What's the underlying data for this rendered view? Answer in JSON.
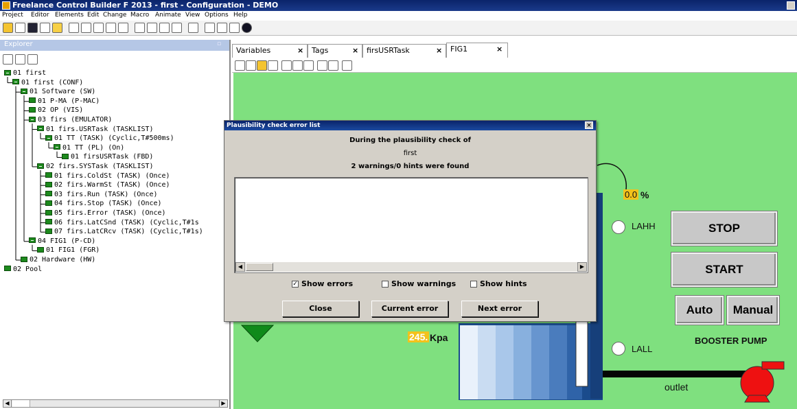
{
  "window": {
    "title": "Freelance Control Builder F 2013 - first - Configuration - DEMO"
  },
  "menu": [
    "Project",
    "Editor",
    "Elements",
    "Edit",
    "Change",
    "Macro",
    "Animate",
    "View",
    "Options",
    "Help"
  ],
  "explorer": {
    "title": "Explorer",
    "tree": [
      {
        "label": "01 first",
        "level": 0
      },
      {
        "label": "01 first  (CONF)",
        "level": 1
      },
      {
        "label": "01 Software  (SW)",
        "level": 2
      },
      {
        "label": "01 P-MA  (P-MAC)",
        "level": 3
      },
      {
        "label": "02 OP  (VIS)",
        "level": 3
      },
      {
        "label": "03 firs  (EMULATOR)",
        "level": 3
      },
      {
        "label": "01 firs.USRTask  (TASKLIST)",
        "level": 4
      },
      {
        "label": "01 TT  (TASK) (Cyclic,T#500ms)",
        "level": 5
      },
      {
        "label": "01 TT  (PL) (On)",
        "level": 6
      },
      {
        "label": "01 firsUSRTask  (FBD)",
        "level": 7
      },
      {
        "label": "02 firs.SYSTask  (TASKLIST)",
        "level": 4
      },
      {
        "label": "01 firs.ColdSt  (TASK) (Once)",
        "level": 5
      },
      {
        "label": "02 firs.WarmSt  (TASK) (Once)",
        "level": 5
      },
      {
        "label": "03 firs.Run  (TASK) (Once)",
        "level": 5
      },
      {
        "label": "04 firs.Stop  (TASK) (Once)",
        "level": 5
      },
      {
        "label": "05 firs.Error  (TASK) (Once)",
        "level": 5
      },
      {
        "label": "06 firs.LatCSnd  (TASK) (Cyclic,T#1s",
        "level": 5
      },
      {
        "label": "07 firs.LatCRcv  (TASK) (Cyclic,T#1s)",
        "level": 5
      },
      {
        "label": "04 FIG1  (P-CD)",
        "level": 3
      },
      {
        "label": "01 FIG1  (FGR)",
        "level": 4
      },
      {
        "label": "02 Hardware  (HW)",
        "level": 2
      },
      {
        "label": "02 Pool",
        "level": 0
      }
    ]
  },
  "tabs": [
    {
      "label": "Variables"
    },
    {
      "label": "Tags"
    },
    {
      "label": "firsUSRTask"
    },
    {
      "label": "FIG1"
    }
  ],
  "tab_close": "×",
  "dialog": {
    "title": "Plausibility check error list",
    "line1": "During the  plausibility check of",
    "line2": "first",
    "line3": "2 warnings/0 hints were found",
    "show_errors": "Show errors",
    "show_warnings": "Show warnings",
    "show_hints": "Show hints",
    "show_errors_checked": true,
    "show_warnings_checked": false,
    "show_hints_checked": false,
    "close": "Close",
    "current_error": "Current error",
    "next_error": "Next error",
    "close_x": "×"
  },
  "hmi": {
    "level_value": "0.0",
    "level_unit": "%",
    "lahh": "LAHH",
    "lall": "LALL",
    "stop": "STOP",
    "start": "START",
    "auto": "Auto",
    "manual": "Manual",
    "booster": "BOOSTER PUMP",
    "pressure_value": "245.",
    "pressure_unit": "Kpa",
    "outlet": "outlet"
  },
  "colors": {
    "canvas": "#7fe07f",
    "value_highlight": "#f3c21b",
    "pump": "#ee1111",
    "tree_node": "#1d8a1d"
  }
}
